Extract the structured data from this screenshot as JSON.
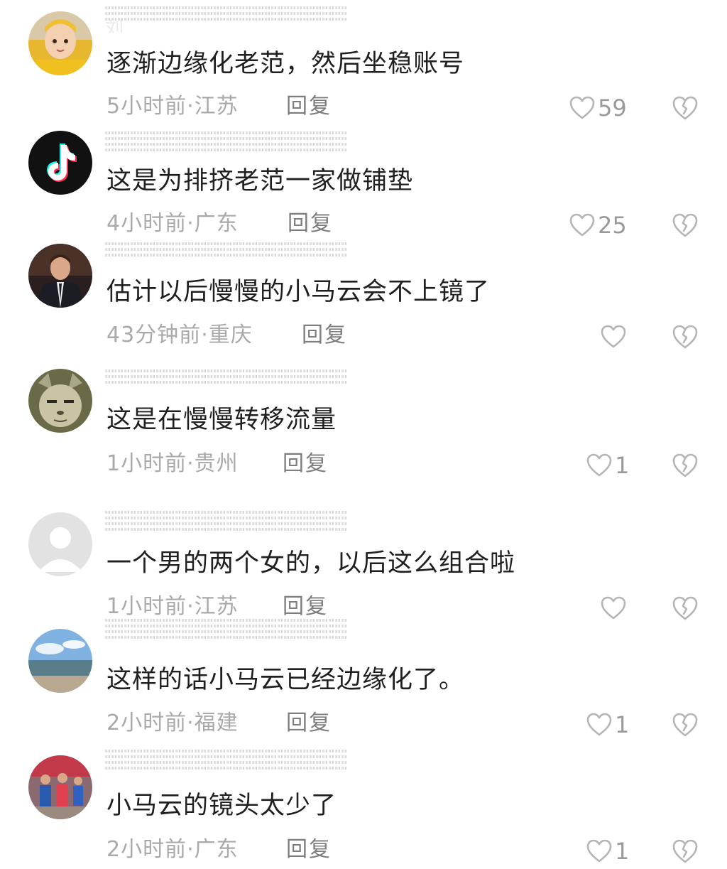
{
  "comments": [
    {
      "username": "刘",
      "text": "逐渐边缘化老范，然后坐稳账号",
      "time": "5小时前",
      "location": "江苏",
      "reply_label": "回复",
      "likes": "59",
      "avatar": "child-photo-avatar"
    },
    {
      "username": "",
      "text": "这是为排挤老范一家做铺垫",
      "time": "4小时前",
      "location": "广东",
      "reply_label": "回复",
      "likes": "25",
      "avatar": "tiktok-logo-avatar"
    },
    {
      "username": "",
      "text": "估计以后慢慢的小马云会不上镜了",
      "time": "43分钟前",
      "location": "重庆",
      "reply_label": "回复",
      "likes": "",
      "avatar": "man-in-suit-avatar"
    },
    {
      "username": "",
      "text": "这是在慢慢转移流量",
      "time": "1小时前",
      "location": "贵州",
      "reply_label": "回复",
      "likes": "1",
      "avatar": "cartoon-animal-avatar"
    },
    {
      "username": "",
      "text": "一个男的两个女的，以后这么组合啦",
      "time": "1小时前",
      "location": "江苏",
      "reply_label": "回复",
      "likes": "",
      "avatar": "default-user-avatar"
    },
    {
      "username": "",
      "text": "这样的话小马云已经边缘化了。",
      "time": "2小时前",
      "location": "福建",
      "reply_label": "回复",
      "likes": "1",
      "avatar": "seascape-avatar"
    },
    {
      "username": "",
      "text": "小马云的镜头太少了",
      "time": "2小时前",
      "location": "广东",
      "reply_label": "回复",
      "likes": "1",
      "avatar": "group-photo-avatar"
    }
  ],
  "meta_separator": "·",
  "colors": {
    "comment_text": "#1f1f1f",
    "meta_text": "#a9a9a9",
    "reply_text": "#7d7d7d",
    "icon_stroke": "#b5b5b5",
    "background": "#ffffff"
  }
}
